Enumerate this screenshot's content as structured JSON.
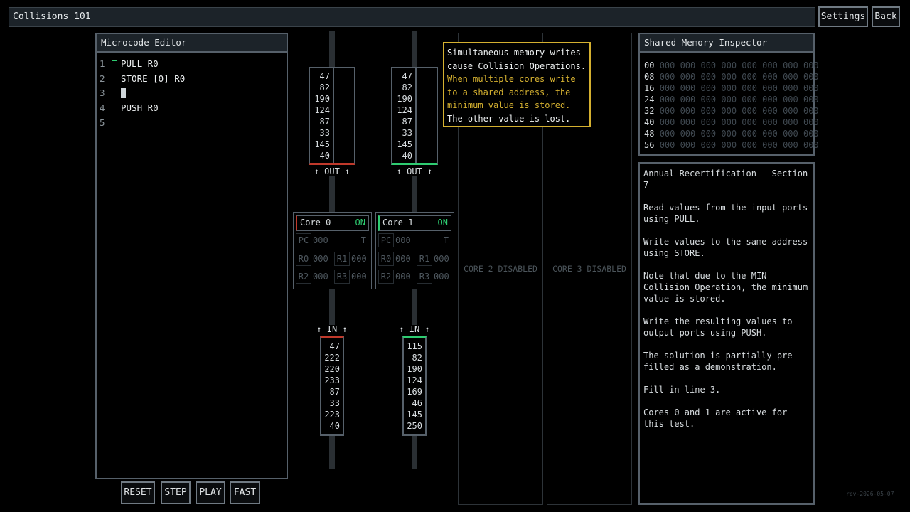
{
  "title": "Collisions 101",
  "nav": {
    "settings": "Settings",
    "back": "Back"
  },
  "editor": {
    "title": "Microcode Editor",
    "line_numbers": [
      "1",
      "2",
      "3",
      "4",
      "5"
    ],
    "lines": [
      "PULL R0",
      "STORE [0] R0",
      "",
      "PUSH R0",
      ""
    ]
  },
  "controls": {
    "reset": "RESET",
    "step": "STEP",
    "play": "PLAY",
    "fast": "FAST"
  },
  "out_label": "↑ OUT ↑",
  "in_label": "↑ IN ↑",
  "out_ports": [
    {
      "values": [
        "47",
        "82",
        "190",
        "124",
        "87",
        "33",
        "145",
        "40"
      ],
      "accent": "#c0392b"
    },
    {
      "values": [
        "47",
        "82",
        "190",
        "124",
        "87",
        "33",
        "145",
        "40"
      ],
      "accent": "#2ecc71"
    }
  ],
  "in_ports": [
    {
      "values": [
        "47",
        "222",
        "220",
        "233",
        "87",
        "33",
        "223",
        "40"
      ],
      "accent": "#c0392b"
    },
    {
      "values": [
        "115",
        "82",
        "190",
        "124",
        "169",
        "46",
        "145",
        "250"
      ],
      "accent": "#2ecc71"
    }
  ],
  "cores": [
    {
      "name": "Core 0",
      "status": "ON",
      "pc_label": "PC",
      "pc": "000",
      "t": "T",
      "r0_label": "R0",
      "r0": "000",
      "r1_label": "R1",
      "r1": "000",
      "r2_label": "R2",
      "r2": "000",
      "r3_label": "R3",
      "r3": "000",
      "accent": "#c0392b"
    },
    {
      "name": "Core 1",
      "status": "ON",
      "pc_label": "PC",
      "pc": "000",
      "t": "T",
      "r0_label": "R0",
      "r0": "000",
      "r1_label": "R1",
      "r1": "000",
      "r2_label": "R2",
      "r2": "000",
      "r3_label": "R3",
      "r3": "000",
      "accent": "#2ecc71"
    }
  ],
  "disabled": {
    "core2": "CORE 2 DISABLED",
    "core3": "CORE 3 DISABLED"
  },
  "tooltip": {
    "line1": "Simultaneous memory writes",
    "line2": "cause Collision Operations.",
    "line3": "When multiple cores write",
    "line4": "to a shared address, the",
    "line5": "minimum value is stored.",
    "line6": "The other value is lost."
  },
  "memory": {
    "title": "Shared Memory Inspector",
    "rows": [
      {
        "addr": "00",
        "cells": "000 000 000 000 000 000 000 000"
      },
      {
        "addr": "08",
        "cells": "000 000 000 000 000 000 000 000"
      },
      {
        "addr": "16",
        "cells": "000 000 000 000 000 000 000 000"
      },
      {
        "addr": "24",
        "cells": "000 000 000 000 000 000 000 000"
      },
      {
        "addr": "32",
        "cells": "000 000 000 000 000 000 000 000"
      },
      {
        "addr": "40",
        "cells": "000 000 000 000 000 000 000 000"
      },
      {
        "addr": "48",
        "cells": "000 000 000 000 000 000 000 000"
      },
      {
        "addr": "56",
        "cells": "000 000 000 000 000 000 000 000"
      }
    ]
  },
  "instructions": {
    "p1": "Annual Recertification - Section 7",
    "p2": "Read values from the input ports using PULL.",
    "p3": "Write values to the same address using STORE.",
    "p4": "Note that due to the MIN Collision Operation, the minimum value is stored.",
    "p5": "Write the resulting values to output ports using PUSH.",
    "p6": "The solution is partially pre-filled as a demonstration.",
    "p7": "Fill in line 3.",
    "p8": "Cores 0 and 1 are active for this test."
  },
  "version": "rev-2026-05-07",
  "colors": {
    "tooltip": "#d4b030",
    "on": "#2ecc71",
    "panel_border": "#56606a"
  }
}
